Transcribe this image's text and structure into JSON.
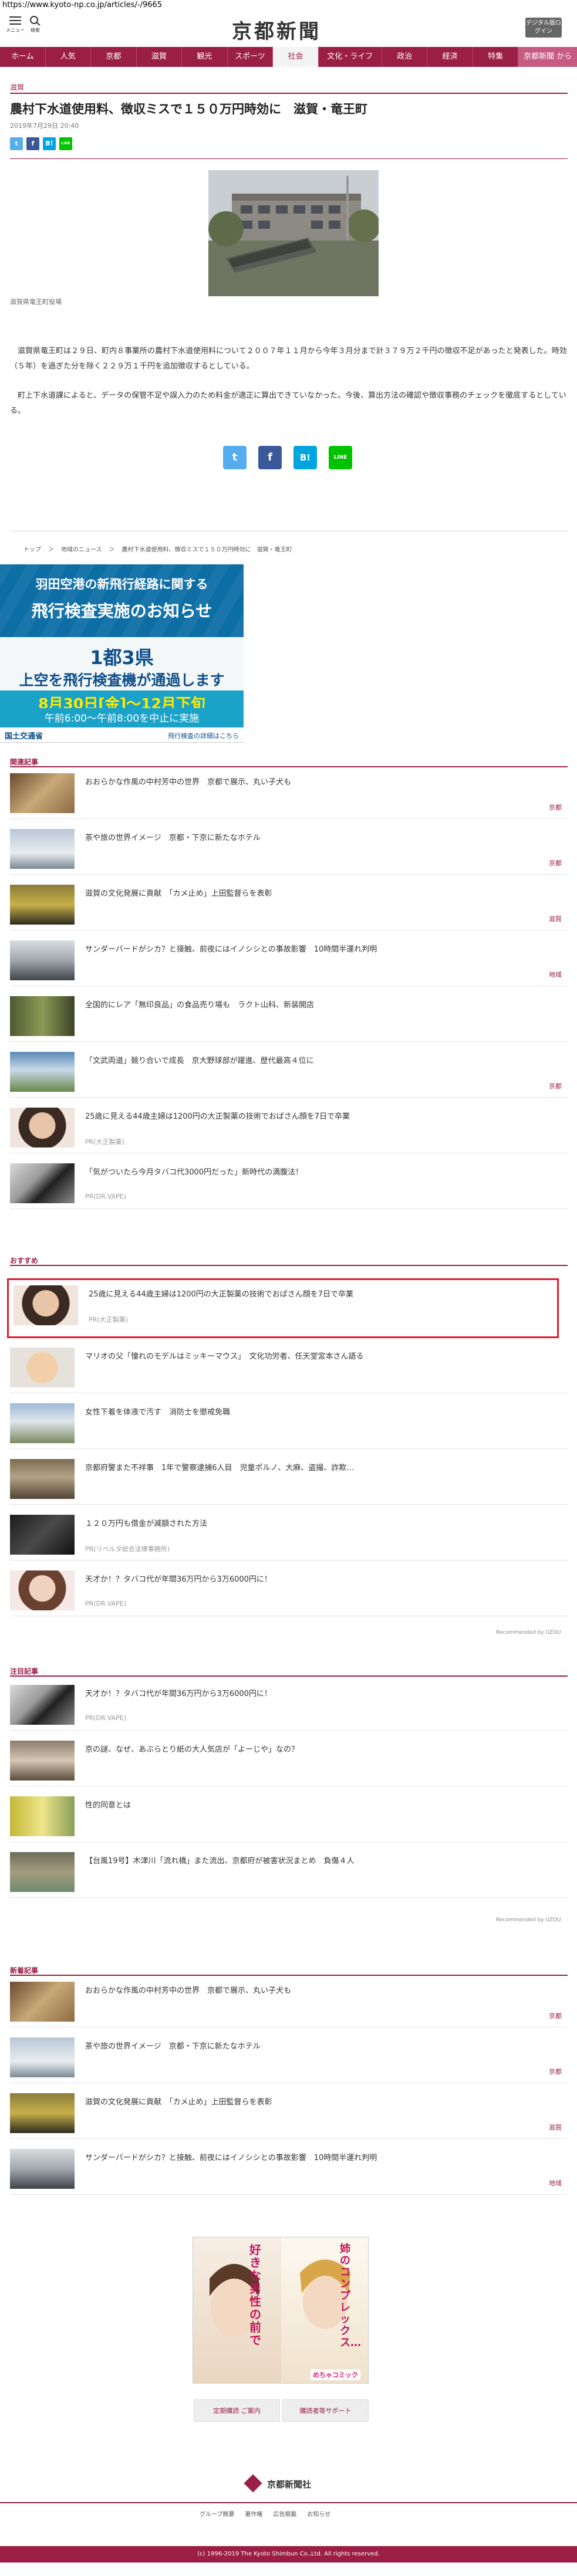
{
  "browser": {
    "url": "https://www.kyoto-np.co.jp/articles/-/9665"
  },
  "header": {
    "menu_label": "メニュー",
    "search_label": "検索",
    "logo": "京都新聞",
    "digital_btn": "デジタル版ログイン"
  },
  "nav": {
    "items": [
      "ホーム",
      "人気",
      "京都",
      "滋賀",
      "観光",
      "スポーツ",
      "社会",
      "文化・ライフ",
      "政治",
      "経済",
      "特集",
      "京都新聞 から"
    ]
  },
  "article": {
    "section": "滋賀",
    "title": "農村下水道使用料、徴収ミスで１５０万円時効に　滋賀・竜王町",
    "date": "2019年7月29日 20:40",
    "caption": "滋賀県竜王町役場",
    "paragraphs": [
      "　滋賀県竜王町は２９日、町内８事業所の農村下水道使用料について２００７年１１月から今年３月分まで計３７９万２千円の徴収不足があったと発表した。時効（５年）を過ぎた分を除く２２９万１千円を追加徴収するとしている。",
      "　町上下水道課によると、データの保管不足や誤入力のため料金が適正に算出できていなかった。今後、算出方法の確認や徴収事務のチェックを徹底するとしている。"
    ]
  },
  "share": {
    "twitter": "t",
    "facebook": "f",
    "hatena": "B!",
    "line": "LINE"
  },
  "breadcrumb": [
    "トップ",
    "＞",
    "地域のニュース",
    "＞",
    "農村下水道使用料、徴収ミスで１５０万円時効に　滋賀・竜王町"
  ],
  "ad1": {
    "line1": "羽田空港の新飛行経路に関する",
    "line2": "飛行検査実施のお知らせ",
    "line3": "1都3県",
    "line4": "上空を飛行検査機が通過します",
    "line5": "8月30日[金]〜12月下旬",
    "line6": "午前6:00〜午前8:00を中止に実施",
    "org": "国土交通省",
    "more": "飛行検査の詳細はこちら"
  },
  "related": {
    "title": "関連記事",
    "items": [
      {
        "title": "おおらかな作風の中村芳中の世界　京都で展示、丸い子犬も",
        "tag": "京都"
      },
      {
        "title": "茶や旅の世界イメージ　京都・下京に新たなホテル",
        "tag": "京都"
      },
      {
        "title": "滋賀の文化発展に貢献　「カメ止め」上田監督らを表彰",
        "tag": "滋賀"
      },
      {
        "title": "サンダーバードがシカ？と接触、前夜にはイノシシとの事故影響　10時間半運れ判明",
        "tag": "地域"
      },
      {
        "title": "全国的にレア「無印良品」の食品売り場も　ラクト山科、新装開店",
        "tag": ""
      },
      {
        "title": "「文武両道」競り合いで成長　京大野球部が躍進、歴代最高４位に",
        "tag": "京都"
      },
      {
        "title": "25歳に見える44歳主婦は1200円の大正製薬の技術でおばさん顔を7日で卒業",
        "tag": "",
        "sub": "PR(大正製薬)"
      },
      {
        "title": "「気がついたら今月タバコ代3000円だった」新時代の満腹法！",
        "tag": "",
        "sub": "PR(DR.VAPE)"
      }
    ]
  },
  "recommend": {
    "title": "おすすめ",
    "items": [
      {
        "title": "25歳に見える44歳主婦は1200円の大正製薬の技術でおばさん顔を7日で卒業",
        "sub": "PR(大正製薬)"
      },
      {
        "title": "マリオの父「憧れのモデルはミッキーマウス」　文化功労者、任天堂宮本さん語る",
        "sub": ""
      },
      {
        "title": "女性下着を体液で汚す　消防士を懲戒免職",
        "sub": ""
      },
      {
        "title": "京都府警また不祥事　1年で警察逮捕6人目　児童ポルノ、大麻、盗撮、詐欺…",
        "sub": ""
      },
      {
        "title": "１２０万円も借金が減額された方法",
        "sub": "PR(リベルタ総合法律事務所)"
      },
      {
        "title": "天才か！？タバコ代が年間36万円から3万6000円に！",
        "sub": "PR(DR.VAPE)"
      }
    ],
    "credit": "Recommended by UZOU"
  },
  "featured": {
    "title": "注目記事",
    "items": [
      {
        "title": "天才か！？タバコ代が年間36万円から3万6000円に！",
        "sub": "PR(DR.VAPE)"
      },
      {
        "title": "京の謎、なぜ、あぶらとり紙の大人気店が「よーじや」なの？",
        "sub": ""
      },
      {
        "title": "性的同意とは",
        "sub": ""
      },
      {
        "title": "【台風19号】木津川「流れ橋」また流出、京都府が被害状況まとめ　負傷４人",
        "sub": ""
      }
    ],
    "credit": "Recommended by UZOU"
  },
  "latest": {
    "title": "新着記事",
    "items": [
      {
        "title": "おおらかな作風の中村芳中の世界　京都で展示、丸い子犬も",
        "tag": "京都"
      },
      {
        "title": "茶や旅の世界イメージ　京都・下京に新たなホテル",
        "tag": "京都"
      },
      {
        "title": "滋賀の文化発展に貢献　「カメ止め」上田監督らを表彰",
        "tag": "滋賀"
      },
      {
        "title": "サンダーバードがシカ？と接触、前夜にはイノシシとの事故影響　10時間半運れ判明",
        "tag": "地域"
      }
    ]
  },
  "ad2": {
    "text1": "好きな男性の前で",
    "text2": "姉のコンプレックス…",
    "brand": "めちゃコミック"
  },
  "footer": {
    "btn1": "定期購読 ご案内",
    "btn2": "購読者等サポート",
    "logo": "京都新聞社",
    "links": [
      "グループ概要",
      "著作権",
      "広告掲載",
      "お知らせ"
    ],
    "copyright": "(c) 1996-2019 The Kyoto Shimbun Co.,Ltd. All rights reserved."
  },
  "colors": {
    "accent": "#9a1e46",
    "twitter": "#55acee",
    "facebook": "#3b5998",
    "hatena": "#00a4de",
    "line": "#00c300",
    "highlight": "#e01b2d"
  }
}
